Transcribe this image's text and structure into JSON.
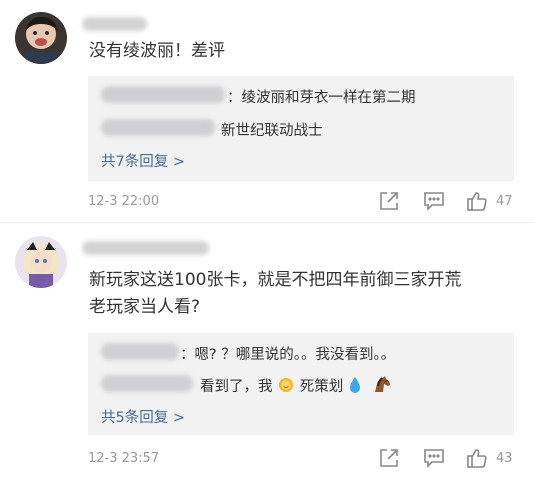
{
  "comments": [
    {
      "text": "没有绫波丽！差评",
      "replies": [
        {
          "text": "：绫波丽和芽衣一样在第二期"
        },
        {
          "text": "新世纪联动战士"
        }
      ],
      "more_replies": "共7条回复 >",
      "time": "12-3 22:00",
      "likes": "47"
    },
    {
      "text_line1": "新玩家这送100张卡，就是不把四年前御三家开荒",
      "text_line2": "老玩家当人看?",
      "replies": [
        {
          "text": "：嗯? ？哪里说的。。我没看到。。"
        },
        {
          "text_before": "看到了，我",
          "text_after": "死策划"
        }
      ],
      "more_replies": "共5条回复 >",
      "time": "12-3 23:57",
      "likes": "43"
    }
  ],
  "icons": {
    "share": "share-icon",
    "comment": "comment-icon",
    "like": "thumbs-up-icon"
  },
  "colors": {
    "link": "#4a6b95",
    "reply_bg": "#f2f2f2",
    "meta_gray": "#999999"
  }
}
